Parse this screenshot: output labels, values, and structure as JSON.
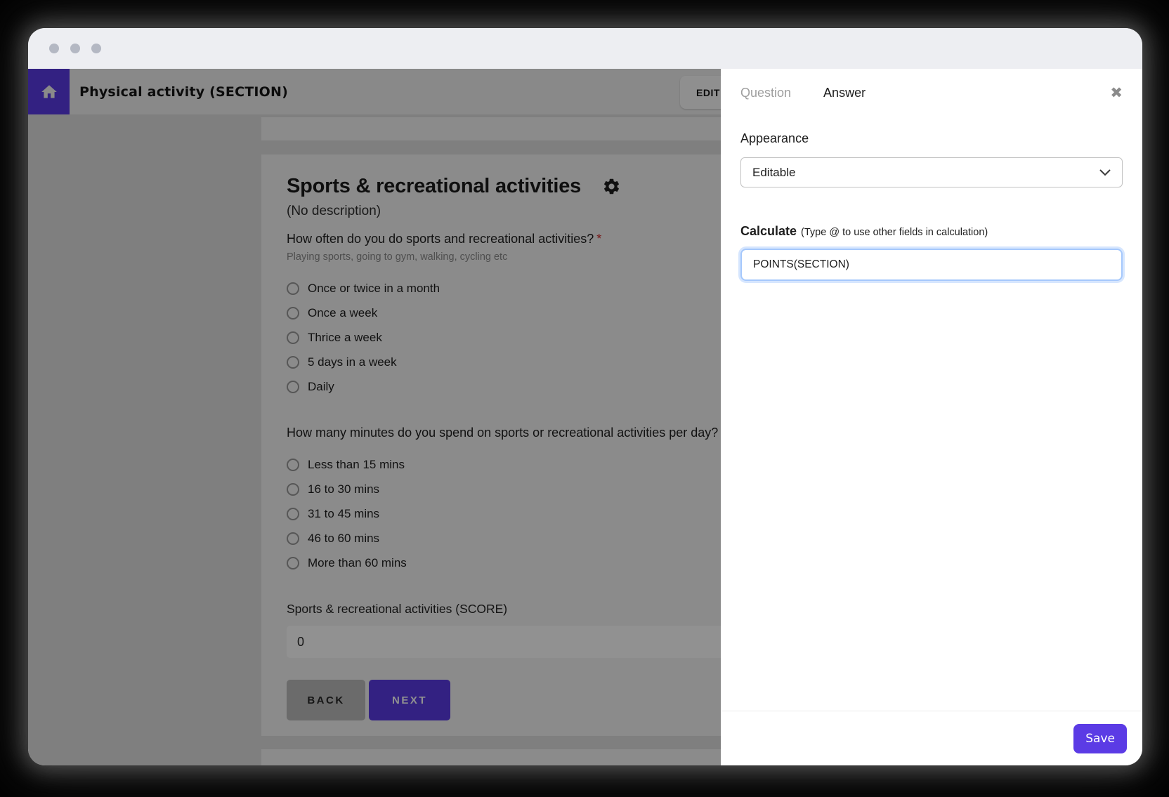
{
  "colors": {
    "accent": "#5b3be5",
    "titlebar": "#edeef2",
    "header": "#f1f1f1",
    "page": "#e0e0e0",
    "card": "#f5f5f5",
    "asterisk": "#d32f2f",
    "focus": "#a5c8fc"
  },
  "header": {
    "title": "Physical activity (SECTION)",
    "edit_label": "EDIT"
  },
  "form": {
    "title": "Sports & recreational activities",
    "description": "(No description)",
    "required_marker": "*",
    "questions": [
      {
        "text": "How often do you do sports and recreational activities?",
        "helper": "Playing sports, going to gym, walking, cycling etc",
        "options": [
          "Once or twice in a month",
          "Once a week",
          "Thrice a week",
          "5 days in a week",
          "Daily"
        ]
      },
      {
        "text": "How many minutes do you spend on sports or recreational activities per day?",
        "options": [
          "Less than 15 mins",
          "16 to 30 mins",
          "31 to 45 mins",
          "46 to 60 mins",
          "More than 60 mins"
        ]
      }
    ],
    "score": {
      "label": "Sports & recreational activities (SCORE)",
      "value": "0"
    },
    "back_label": "BACK",
    "next_label": "NEXT"
  },
  "panel": {
    "tabs": [
      {
        "label": "Question"
      },
      {
        "label": "Answer"
      }
    ],
    "close_icon": "✖",
    "appearance": {
      "label": "Appearance",
      "value": "Editable"
    },
    "calculate": {
      "label": "Calculate",
      "note": "(Type @ to use other fields in calculation)",
      "value": "POINTS(SECTION)"
    },
    "save_label": "Save"
  }
}
